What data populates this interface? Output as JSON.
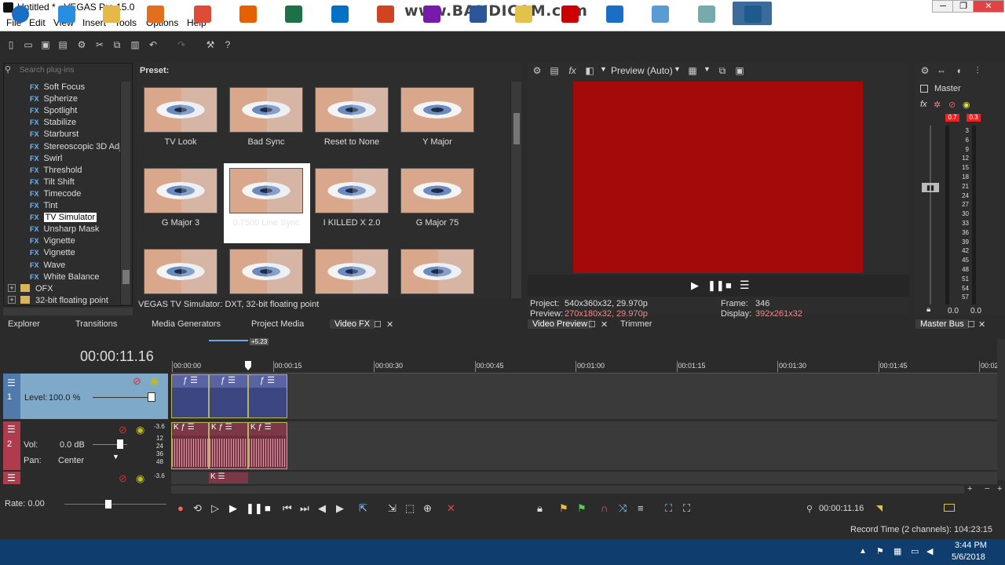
{
  "window": {
    "title": "Untitled * - VEGAS Pro 15.0",
    "watermark": "www.BANDICAM.com"
  },
  "menu": [
    "File",
    "Edit",
    "View",
    "Insert",
    "Tools",
    "Options",
    "Help"
  ],
  "plugins": {
    "search_placeholder": "Search plug-ins",
    "items": [
      {
        "label": "Soft Focus",
        "badge": "FX"
      },
      {
        "label": "Spherize",
        "badge": "FX"
      },
      {
        "label": "Spotlight",
        "badge": "FX"
      },
      {
        "label": "Stabilize",
        "badge": "FX"
      },
      {
        "label": "Starburst",
        "badge": "FX"
      },
      {
        "label": "Stereoscopic 3D Adj",
        "badge": "FX"
      },
      {
        "label": "Swirl",
        "badge": "FX"
      },
      {
        "label": "Threshold",
        "badge": "FX"
      },
      {
        "label": "Tilt Shift",
        "badge": "FX"
      },
      {
        "label": "Timecode",
        "badge": "FX"
      },
      {
        "label": "Tint",
        "badge": "FX"
      },
      {
        "label": "TV Simulator",
        "badge": "FX",
        "selected": true
      },
      {
        "label": "Unsharp Mask",
        "badge": "FX"
      },
      {
        "label": "Vignette",
        "badge": "FX"
      },
      {
        "label": "Vignette",
        "badge": "FX"
      },
      {
        "label": "Wave",
        "badge": "FX"
      },
      {
        "label": "White Balance",
        "badge": "FX"
      }
    ],
    "folders": [
      "OFX",
      "32-bit floating point"
    ]
  },
  "presets": {
    "header": "Preset:",
    "items": [
      "TV Look",
      "Bad Sync",
      "Reset to None",
      "Y Major",
      "G Major 3",
      "0.7500 Line Sync",
      "I KILLED X 2.0",
      "G Major 75",
      "",
      "",
      "",
      ""
    ],
    "status": "VEGAS TV Simulator: DXT, 32-bit floating point"
  },
  "left_tabs": [
    "Explorer",
    "Transitions",
    "Media Generators",
    "Project Media",
    "Video FX"
  ],
  "preview": {
    "mode": "Preview (Auto)",
    "project_label": "Project:",
    "project_value": "540x360x32, 29.970p",
    "preview_label": "Preview:",
    "preview_value": "270x180x32, 29.970p",
    "frame_label": "Frame:",
    "frame_value": "346",
    "display_label": "Display:",
    "display_value": "392x261x32",
    "tabs": [
      "Video Preview",
      "Trimmer"
    ],
    "frame_color": "#a40a0a"
  },
  "master": {
    "title": "Master",
    "peak_left": "0.7",
    "peak_right": "0.3",
    "scale": [
      "3",
      "6",
      "9",
      "12",
      "15",
      "18",
      "21",
      "24",
      "27",
      "30",
      "33",
      "36",
      "39",
      "42",
      "45",
      "48",
      "51",
      "54",
      "57"
    ],
    "bottom_left": "0.0",
    "bottom_right": "0.0",
    "tab": "Master Bus"
  },
  "timeline": {
    "timecode": "00:00:11.16",
    "marker": "+5.23",
    "ruler": [
      "00:00:00",
      "00:00:15",
      "00:00:30",
      "00:00:45",
      "00:01:00",
      "00:01:15",
      "00:01:30",
      "00:01:45",
      "00:02"
    ],
    "track1": {
      "num": "1",
      "level_label": "Level:",
      "level": "100.0 %"
    },
    "track2": {
      "num": "2",
      "vol_label": "Vol:",
      "vol": "0.0 dB",
      "pan_label": "Pan:",
      "pan": "Center",
      "db_marks": [
        "-3.6",
        "12",
        "24",
        "36",
        "48"
      ]
    },
    "track3": {
      "db": "-3.6"
    },
    "rate": "Rate: 0.00",
    "cursor_time": "00:00:11.16"
  },
  "status": {
    "record": "Record Time (2 channels): 104:23:15"
  },
  "clock": {
    "time": "3:44 PM",
    "date": "5/6/2018"
  }
}
